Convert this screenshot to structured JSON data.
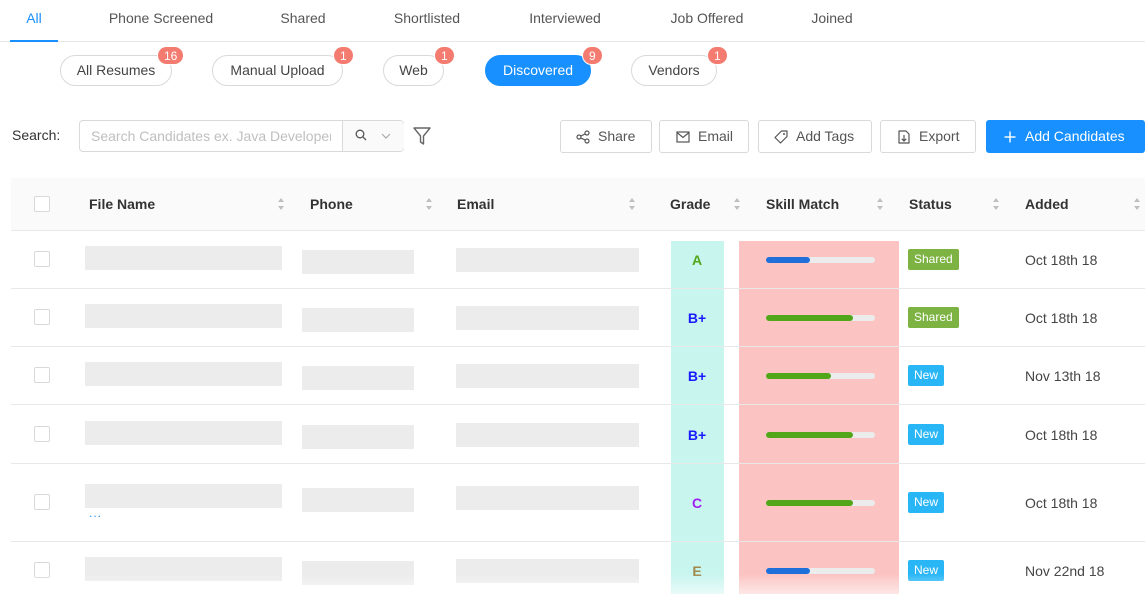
{
  "tabs": [
    {
      "label": "All",
      "active": true
    },
    {
      "label": "Phone Screened"
    },
    {
      "label": "Shared"
    },
    {
      "label": "Shortlisted"
    },
    {
      "label": "Interviewed"
    },
    {
      "label": "Job Offered"
    },
    {
      "label": "Joined"
    }
  ],
  "sources": [
    {
      "label": "All Resumes",
      "count": "16"
    },
    {
      "label": "Manual Upload",
      "count": "1"
    },
    {
      "label": "Web",
      "count": "1"
    },
    {
      "label": "Discovered",
      "count": "9",
      "active": true
    },
    {
      "label": "Vendors",
      "count": "1"
    }
  ],
  "search": {
    "label": "Search",
    "placeholder": "Search Candidates ex. Java Developer"
  },
  "actions": {
    "share": "Share",
    "email": "Email",
    "add_tags": "Add Tags",
    "export": "Export",
    "add_candidates": "Add Candidates"
  },
  "table": {
    "columns": {
      "file_name": "File Name",
      "phone": "Phone",
      "email": "Email",
      "grade": "Grade",
      "skill_match": "Skill Match",
      "status": "Status",
      "added": "Added"
    },
    "rows": [
      {
        "grade": "A",
        "skill_match": 0.4,
        "status": "Shared",
        "added": "Oct 18th 18"
      },
      {
        "grade": "B+",
        "skill_match": 0.8,
        "status": "Shared",
        "added": "Oct 18th 18"
      },
      {
        "grade": "B+",
        "skill_match": 0.6,
        "status": "New",
        "added": "Nov 13th 18"
      },
      {
        "grade": "B+",
        "skill_match": 0.8,
        "status": "New",
        "added": "Oct 18th 18"
      },
      {
        "grade": "C",
        "skill_match": 0.8,
        "status": "New",
        "added": "Oct 18th 18",
        "more": "..."
      },
      {
        "grade": "E",
        "skill_match": 0.4,
        "status": "New",
        "added": "Nov 22nd 18"
      }
    ]
  },
  "colors": {
    "accent": "#1890ff",
    "badge": "#f47b70",
    "grade_highlight": "#c9f5ef",
    "skill_highlight": "#fbc4c2",
    "status_shared": "#7cb342",
    "status_new": "#29b6f6",
    "skill_high": "#52a61a",
    "skill_low": "#1f6fdb",
    "grade_A": "#52a61a",
    "grade_B+": "#1a1aff",
    "grade_C": "#a020f0",
    "grade_E": "#a0894d"
  }
}
